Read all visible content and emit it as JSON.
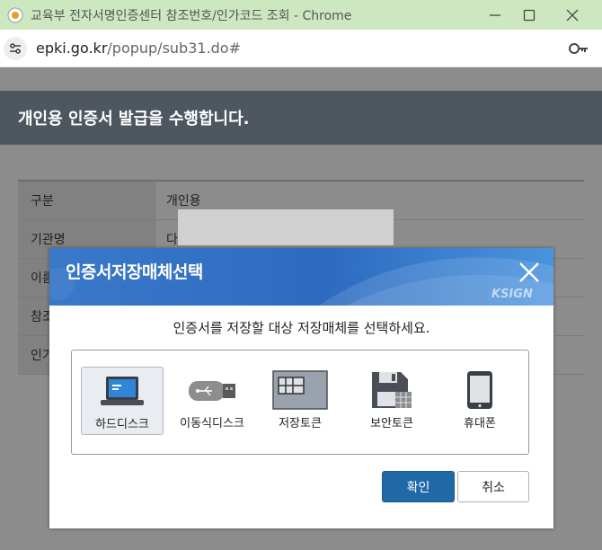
{
  "browser": {
    "window_title": "교육부 전자서명인증센터 참조번호/인가코드 조회 - Chrome",
    "url_host": "epki.go.kr",
    "url_path": "/popup/sub31.do#",
    "titlebar_color": "#cde8c0"
  },
  "page": {
    "header_title": "개인용 인증서 발급을 수행합니다.",
    "table": {
      "rows": [
        {
          "label": "구분",
          "value": "개인용"
        },
        {
          "label": "기관명",
          "value": "다"
        },
        {
          "label": "이름",
          "value": ""
        },
        {
          "label": "참조",
          "value": ""
        },
        {
          "label": "인가",
          "value": ""
        }
      ]
    }
  },
  "dialog": {
    "title": "인증서저장매체선택",
    "brand": "KSIGN",
    "message": "인증서를 저장할 대상 저장매체를 선택하세요.",
    "media": [
      {
        "label": "하드디스크",
        "icon": "laptop-icon",
        "selected": true
      },
      {
        "label": "이동식디스크",
        "icon": "usb-drive-icon",
        "selected": false
      },
      {
        "label": "저장토큰",
        "icon": "storage-token-icon",
        "selected": false
      },
      {
        "label": "보안토큰",
        "icon": "floppy-disk-icon",
        "selected": false
      },
      {
        "label": "휴대폰",
        "icon": "mobile-phone-icon",
        "selected": false
      }
    ],
    "ok_label": "확인",
    "cancel_label": "취소",
    "accent_color": "#1f69a7"
  }
}
